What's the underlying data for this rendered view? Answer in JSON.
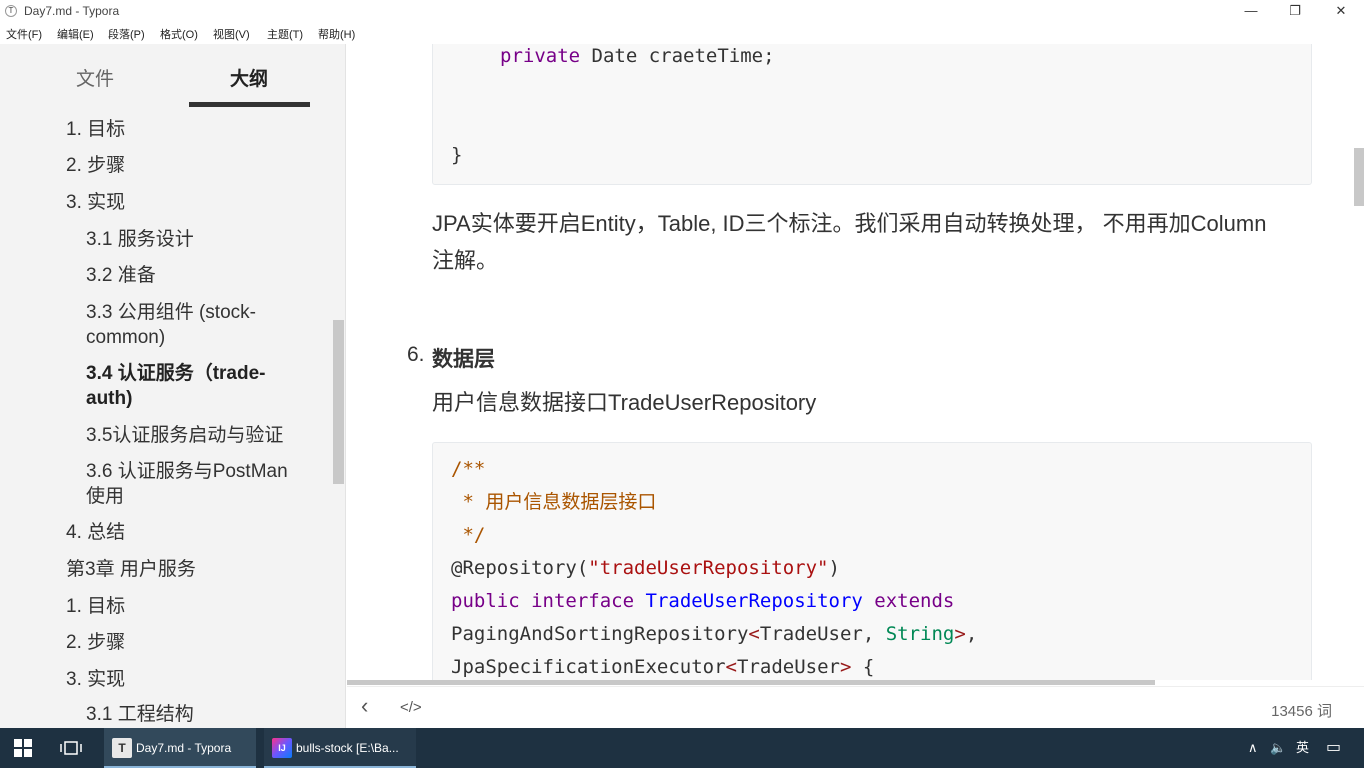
{
  "window": {
    "title": "Day7.md - Typora",
    "app_icon": "T",
    "controls": {
      "minimize": "—",
      "restore": "❐",
      "close": "✕"
    }
  },
  "menubar": [
    "文件(F)",
    "编辑(E)",
    "段落(P)",
    "格式(O)",
    "视图(V)",
    "主题(T)",
    "帮助(H)"
  ],
  "sidebar": {
    "tabs": [
      "文件",
      "大纲"
    ],
    "active_tab": "大纲",
    "outline": [
      {
        "text": "1. 目标",
        "level": 1
      },
      {
        "text": "2. 步骤",
        "level": 1
      },
      {
        "text": "3. 实现",
        "level": 1
      },
      {
        "text": "3.1 服务设计",
        "level": 2
      },
      {
        "text": "3.2 准备",
        "level": 2
      },
      {
        "text": "3.3 公用组件 (stock-",
        "level": 2
      },
      {
        "text": "common)",
        "level": 2
      },
      {
        "text": "3.4 认证服务（trade-",
        "level": 2,
        "active": true
      },
      {
        "text": "auth)",
        "level": 2,
        "active": true
      },
      {
        "text": "3.5认证服务启动与验证",
        "level": 2
      },
      {
        "text": "3.6 认证服务与PostMan",
        "level": 2
      },
      {
        "text": "使用",
        "level": 2
      },
      {
        "text": "4. 总结",
        "level": 1
      },
      {
        "text": "第3章 用户服务",
        "level": 0
      },
      {
        "text": "1. 目标",
        "level": 1
      },
      {
        "text": "2. 步骤",
        "level": 1
      },
      {
        "text": "3. 实现",
        "level": 1
      },
      {
        "text": "3.1 工程结构",
        "level": 2
      }
    ]
  },
  "content": {
    "code1": {
      "line1_kw": "private",
      "line1_rest": " Date craeteTime;",
      "line2": "}"
    },
    "para1_line1": "JPA实体要开启Entity，Table, ID三个标注。我们采用自动转换处理， 不用再加Column",
    "para1_line2": "注解。",
    "heading_num": "6.",
    "heading_text": "数据层",
    "para2": "用户信息数据接口TradeUserRepository",
    "code2": {
      "c1": "/**",
      "c2": " * 用户信息数据层接口",
      "c3": " */",
      "ann": "@Repository(",
      "ann_str": "\"tradeUserRepository\"",
      "ann_close": ")",
      "kw_public": "public",
      "kw_interface": "interface",
      "class_name": "TradeUserRepository",
      "kw_extends": "extends",
      "l6_a": "PagingAndSortingRepository",
      "l6_b": "<",
      "l6_c": "TradeUser",
      "l6_d": ", ",
      "l6_e": "String",
      "l6_f": ">",
      "l6_g": ",",
      "l7_a": "JpaSpecificationExecutor",
      "l7_b": "<",
      "l7_c": "TradeUser",
      "l7_d": ">",
      "l7_e": " {"
    }
  },
  "footer": {
    "back_icon": "‹",
    "source_icon": "</>",
    "word_count": "13456 词"
  },
  "taskbar": {
    "apps": [
      {
        "label": "Day7.md - Typora",
        "icon": "T"
      },
      {
        "label": "bulls-stock [E:\\Ba...",
        "icon": "IJ"
      }
    ],
    "tray": {
      "chevron": "∧",
      "volume": "🔈",
      "ime": "英",
      "notify": "▭"
    }
  },
  "colors": {
    "sidebar_bg": "#f3f3f3",
    "code_bg": "#f8f8f8",
    "keyword": "#770088",
    "comment": "#aa5500",
    "string": "#aa1111",
    "definition": "#0000ff",
    "type": "#008855",
    "taskbar_bg": "#1e3141"
  }
}
